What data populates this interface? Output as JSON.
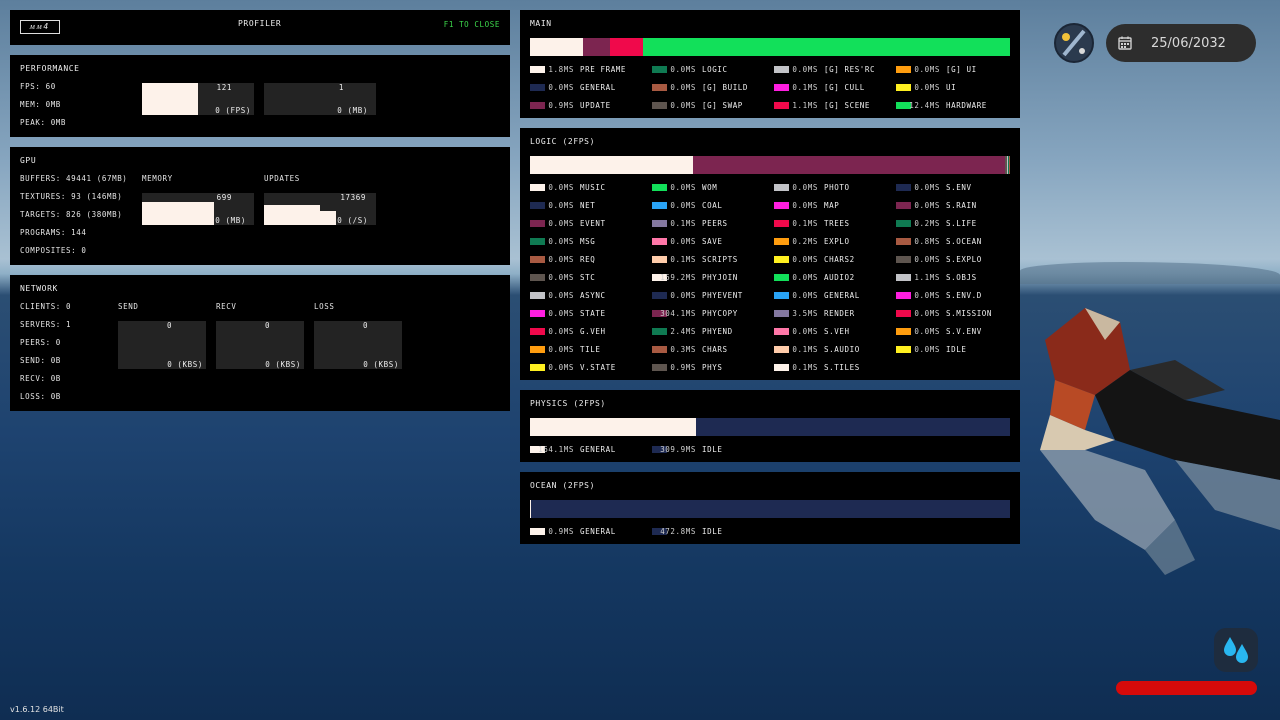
{
  "profiler": {
    "logo": "ᴍᴍ4",
    "title": "PROFILER",
    "close_hint": "F1 TO CLOSE"
  },
  "performance": {
    "title": "PERFORMANCE",
    "fps": "FPS: 60",
    "mem": "MEM: 0MB",
    "peak": "PEAK: 0MB",
    "graph1": {
      "max": "121",
      "min": "0 (FPS)",
      "level": 0.5
    },
    "graph2": {
      "max": "1",
      "min": "0 (MB)",
      "level": 0
    }
  },
  "gpu": {
    "title": "GPU",
    "buffers": "BUFFERS: 49441 (67MB)",
    "textures": "TEXTURES: 93 (146MB)",
    "targets": "TARGETS: 826 (380MB)",
    "programs": "PROGRAMS: 144",
    "composites": "COMPOSITES: 0",
    "memory_title": "MEMORY",
    "memory_graph": {
      "max": "699",
      "min": "0 (MB)",
      "level": 0.72
    },
    "updates_title": "UPDATES",
    "updates_graph": {
      "max": "17369",
      "min": "0 (/S)",
      "level": 0.45
    }
  },
  "network": {
    "title": "NETWORK",
    "clients": "CLIENTS: 0",
    "servers": "SERVERS: 1",
    "peers": "PEERS: 0",
    "send": "SEND: 0B",
    "recv": "RECV: 0B",
    "loss": "LOSS: 0B",
    "send_title": "SEND",
    "recv_title": "RECV",
    "loss_title": "LOSS",
    "send_graph": {
      "max": "0",
      "min": "0 (KBS)"
    },
    "recv_graph": {
      "max": "0",
      "min": "0 (KBS)"
    },
    "loss_graph": {
      "max": "0",
      "min": "0 (KBS)"
    }
  },
  "main": {
    "title": "MAIN",
    "bar": [
      {
        "value": 1.8,
        "color": "#fdf2ea"
      },
      {
        "value": 0.9,
        "color": "#7c2550"
      },
      {
        "value": 1.1,
        "color": "#f0094b"
      },
      {
        "value": 12.4,
        "color": "#12e05a"
      }
    ],
    "legend": [
      [
        {
          "ms": "1.8MS",
          "name": "PRE FRAME",
          "color": "#fdf2ea"
        },
        {
          "ms": "0.0MS",
          "name": "GENERAL",
          "color": "#1e2a52"
        },
        {
          "ms": "0.9MS",
          "name": "UPDATE",
          "color": "#7c2550"
        }
      ],
      [
        {
          "ms": "0.0MS",
          "name": "LOGIC",
          "color": "#0f7a52"
        },
        {
          "ms": "0.0MS",
          "name": "[G] BUILD",
          "color": "#a85a42"
        },
        {
          "ms": "0.0MS",
          "name": "[G] SWAP",
          "color": "#5e554f"
        }
      ],
      [
        {
          "ms": "0.0MS",
          "name": "[G] RES'RC",
          "color": "#c2c3c7"
        },
        {
          "ms": "0.1MS",
          "name": "[G] CULL",
          "color": "#ff1ee0"
        },
        {
          "ms": "1.1MS",
          "name": "[G] SCENE",
          "color": "#f0094b"
        }
      ],
      [
        {
          "ms": "0.0MS",
          "name": "[G] UI",
          "color": "#ff9d0f"
        },
        {
          "ms": "0.0MS",
          "name": "UI",
          "color": "#fff020"
        },
        {
          "ms": "12.4MS",
          "name": "HARDWARE",
          "color": "#12e05a"
        }
      ]
    ]
  },
  "logic": {
    "title": "LOGIC (2FPS)",
    "bar": [
      {
        "value": 159.2,
        "color": "#fdf2ea"
      },
      {
        "value": 304.1,
        "color": "#7c2550"
      },
      {
        "value": 2.4,
        "color": "#5e554f"
      },
      {
        "value": 1.1,
        "color": "#c2c3c7"
      },
      {
        "value": 0.9,
        "color": "#0f7a52"
      },
      {
        "value": 0.8,
        "color": "#a85a42"
      }
    ],
    "legend": [
      [
        {
          "ms": "0.0MS",
          "name": "MUSIC",
          "color": "#fdf2ea"
        },
        {
          "ms": "0.0MS",
          "name": "NET",
          "color": "#1e2a52"
        },
        {
          "ms": "0.0MS",
          "name": "EVENT",
          "color": "#7c2550"
        },
        {
          "ms": "0.0MS",
          "name": "MSG",
          "color": "#0f7a52"
        },
        {
          "ms": "0.0MS",
          "name": "REQ",
          "color": "#a85a42"
        },
        {
          "ms": "0.0MS",
          "name": "STC",
          "color": "#5e554f"
        },
        {
          "ms": "0.0MS",
          "name": "ASYNC",
          "color": "#c2c3c7"
        },
        {
          "ms": "0.0MS",
          "name": "STATE",
          "color": "#ff1ee0"
        },
        {
          "ms": "0.0MS",
          "name": "G.VEH",
          "color": "#f0094b"
        },
        {
          "ms": "0.0MS",
          "name": "TILE",
          "color": "#ff9d0f"
        },
        {
          "ms": "0.0MS",
          "name": "V.STATE",
          "color": "#fff020"
        }
      ],
      [
        {
          "ms": "0.0MS",
          "name": "WOM",
          "color": "#12e05a"
        },
        {
          "ms": "0.0MS",
          "name": "COAL",
          "color": "#29a3f5"
        },
        {
          "ms": "0.1MS",
          "name": "PEERS",
          "color": "#8478a0"
        },
        {
          "ms": "0.0MS",
          "name": "SAVE",
          "color": "#ff77a8"
        },
        {
          "ms": "0.1MS",
          "name": "SCRIPTS",
          "color": "#ffccaa"
        },
        {
          "ms": "159.2MS",
          "name": "PHYJOIN",
          "color": "#fdf2ea"
        },
        {
          "ms": "0.0MS",
          "name": "PHYEVENT",
          "color": "#1e2a52"
        },
        {
          "ms": "304.1MS",
          "name": "PHYCOPY",
          "color": "#7c2550"
        },
        {
          "ms": "2.4MS",
          "name": "PHYEND",
          "color": "#0f7a52"
        },
        {
          "ms": "0.3MS",
          "name": "CHARS",
          "color": "#a85a42"
        },
        {
          "ms": "0.9MS",
          "name": "PHYS",
          "color": "#5e554f"
        }
      ],
      [
        {
          "ms": "0.0MS",
          "name": "PHOTO",
          "color": "#c2c3c7"
        },
        {
          "ms": "0.0MS",
          "name": "MAP",
          "color": "#ff1ee0"
        },
        {
          "ms": "0.1MS",
          "name": "TREES",
          "color": "#f0094b"
        },
        {
          "ms": "0.2MS",
          "name": "EXPLO",
          "color": "#ff9d0f"
        },
        {
          "ms": "0.0MS",
          "name": "CHARS2",
          "color": "#fff020"
        },
        {
          "ms": "0.0MS",
          "name": "AUDIO2",
          "color": "#12e05a"
        },
        {
          "ms": "0.0MS",
          "name": "GENERAL",
          "color": "#29a3f5"
        },
        {
          "ms": "3.5MS",
          "name": "RENDER",
          "color": "#8478a0"
        },
        {
          "ms": "0.0MS",
          "name": "S.VEH",
          "color": "#ff77a8"
        },
        {
          "ms": "0.1MS",
          "name": "S.AUDIO",
          "color": "#ffccaa"
        },
        {
          "ms": "0.1MS",
          "name": "S.TILES",
          "color": "#fdf2ea"
        }
      ],
      [
        {
          "ms": "0.0MS",
          "name": "S.ENV",
          "color": "#1e2a52"
        },
        {
          "ms": "0.0MS",
          "name": "S.RAIN",
          "color": "#7c2550"
        },
        {
          "ms": "0.2MS",
          "name": "S.LIFE",
          "color": "#0f7a52"
        },
        {
          "ms": "0.8MS",
          "name": "S.OCEAN",
          "color": "#a85a42"
        },
        {
          "ms": "0.0MS",
          "name": "S.EXPLO",
          "color": "#5e554f"
        },
        {
          "ms": "1.1MS",
          "name": "S.OBJS",
          "color": "#c2c3c7"
        },
        {
          "ms": "0.0MS",
          "name": "S.ENV.D",
          "color": "#ff1ee0"
        },
        {
          "ms": "0.0MS",
          "name": "S.MISSION",
          "color": "#f0094b"
        },
        {
          "ms": "0.0MS",
          "name": "S.V.ENV",
          "color": "#ff9d0f"
        },
        {
          "ms": "0.0MS",
          "name": "IDLE",
          "color": "#fff020"
        }
      ]
    ]
  },
  "physics": {
    "title": "PHYSICS (2FPS)",
    "bar": [
      {
        "value": 164.1,
        "color": "#fdf2ea"
      },
      {
        "value": 309.9,
        "color": "#1e2a52"
      }
    ],
    "legend": [
      [
        {
          "ms": "164.1MS",
          "name": "GENERAL",
          "color": "#fdf2ea"
        }
      ],
      [
        {
          "ms": "309.9MS",
          "name": "IDLE",
          "color": "#1e2a52"
        }
      ]
    ]
  },
  "ocean": {
    "title": "OCEAN (2FPS)",
    "bar": [
      {
        "value": 0.9,
        "color": "#fdf2ea"
      },
      {
        "value": 472.8,
        "color": "#1e2a52"
      }
    ],
    "legend": [
      [
        {
          "ms": "0.9MS",
          "name": "GENERAL",
          "color": "#fdf2ea"
        }
      ],
      [
        {
          "ms": "472.8MS",
          "name": "IDLE",
          "color": "#1e2a52"
        }
      ]
    ]
  },
  "hud": {
    "date": "25/06/2032",
    "health_level": 1.0
  },
  "version": "v1.6.12 64Bit"
}
